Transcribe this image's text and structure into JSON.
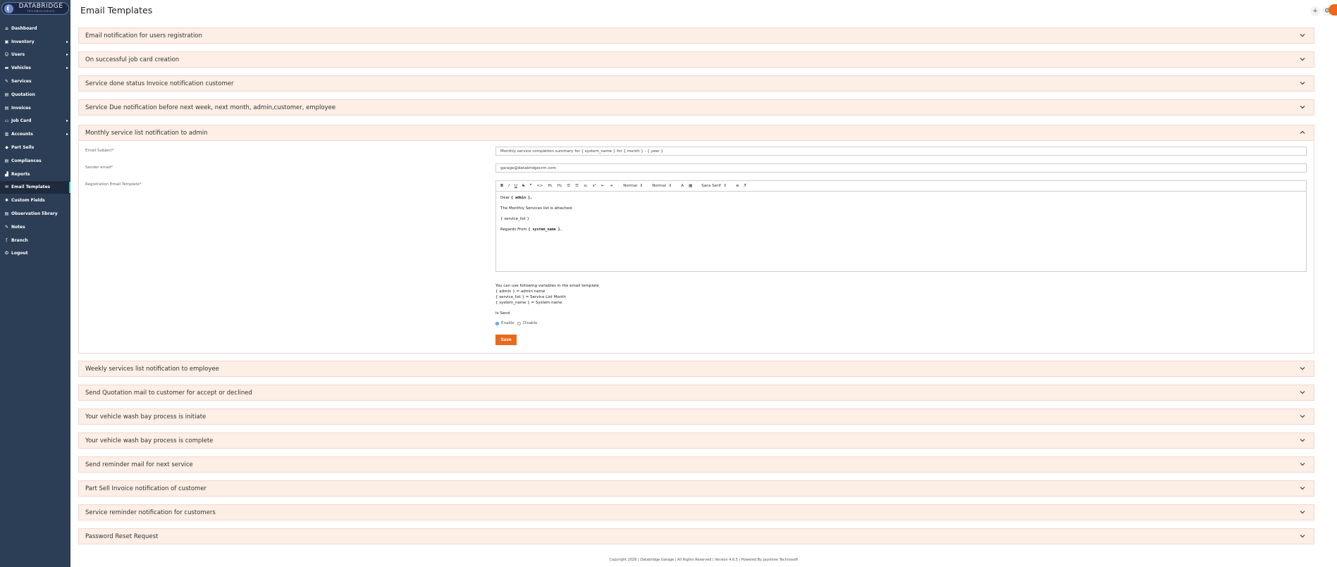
{
  "brand": {
    "name": "DATABRIDGE",
    "tagline": "TECHNOLOGIES"
  },
  "sidebar": {
    "items": [
      {
        "label": "Dashboard",
        "icon": "home-icon"
      },
      {
        "label": "Inventory",
        "icon": "box-icon",
        "has_children": true
      },
      {
        "label": "Users",
        "icon": "user-icon",
        "has_children": true
      },
      {
        "label": "Vehicles",
        "icon": "car-icon",
        "has_children": true
      },
      {
        "label": "Services",
        "icon": "wrench-icon"
      },
      {
        "label": "Quotation",
        "icon": "document-icon"
      },
      {
        "label": "Invoices",
        "icon": "invoice-icon"
      },
      {
        "label": "Job Card",
        "icon": "card-icon",
        "has_children": true
      },
      {
        "label": "Accounts",
        "icon": "bank-icon",
        "has_children": true
      },
      {
        "label": "Part Sells",
        "icon": "tag-icon"
      },
      {
        "label": "Compliances",
        "icon": "file-icon"
      },
      {
        "label": "Reports",
        "icon": "chart-icon"
      },
      {
        "label": "Email Templates",
        "icon": "mail-icon",
        "active": true
      },
      {
        "label": "Custom Fields",
        "icon": "star-icon"
      },
      {
        "label": "Observation library",
        "icon": "book-icon"
      },
      {
        "label": "Notes",
        "icon": "note-icon"
      },
      {
        "label": "Branch",
        "icon": "branch-icon"
      },
      {
        "label": "Logout",
        "icon": "power-icon"
      }
    ]
  },
  "header": {
    "title": "Email Templates",
    "add_icon": "plus-icon",
    "settings_icon": "gear-icon"
  },
  "accordions_before": [
    "Email notification for users registration",
    "On successful job card creation",
    "Service done status Invoice notification customer",
    "Service Due notification before next week, next month, admin,customer, employee"
  ],
  "open_accordion": {
    "title": "Monthly service list notification to admin",
    "subject_label": "Email Subject*",
    "subject_value": "Monthly service completion summary for { system_name } for { month } - { year }",
    "sender_label": "Sender email*",
    "sender_value": "garage@databridgecrm.com",
    "template_label": "Registration Email Template*",
    "toolbar": {
      "normal1": "Normal",
      "normal2": "Normal",
      "font": "Sans Serif"
    },
    "body": {
      "greeting_prefix": "Dear",
      "greeting_var": "{ admin },",
      "line1": "The Monthly Services list is attached.",
      "line2": "{ service_list }",
      "regards_prefix": "Regards From",
      "regards_var": "{ system_name }."
    },
    "help_title": "You can use following variables in the email template",
    "vars": [
      "{ admin } = admin name",
      "{ service_list } = Service List Month",
      "{ system_name } = System name"
    ],
    "is_send_label": "Is Send",
    "enable_label": "Enable",
    "disable_label": "Disable",
    "send_enabled": true,
    "save_label": "Save"
  },
  "accordions_after": [
    "Weekly services list notification to employee",
    "Send Quotation mail to customer for accept or declined",
    "Your vehicle wash bay process is initiate",
    "Your vehicle wash bay process is complete",
    "Send reminder mail for next service",
    "Part Sell Invoice notification of customer",
    "Service reminder notification for customers",
    "Password Reset Request"
  ],
  "footer": "Copyright 2026 | Databridge Garage | All Rights Reserved | Version 4.6.5 | Powered By Jayshree Technosoft",
  "colors": {
    "accent": "#e86a1a",
    "sidebar": "#2c3e55",
    "accordion_bg": "#fdeee6"
  }
}
